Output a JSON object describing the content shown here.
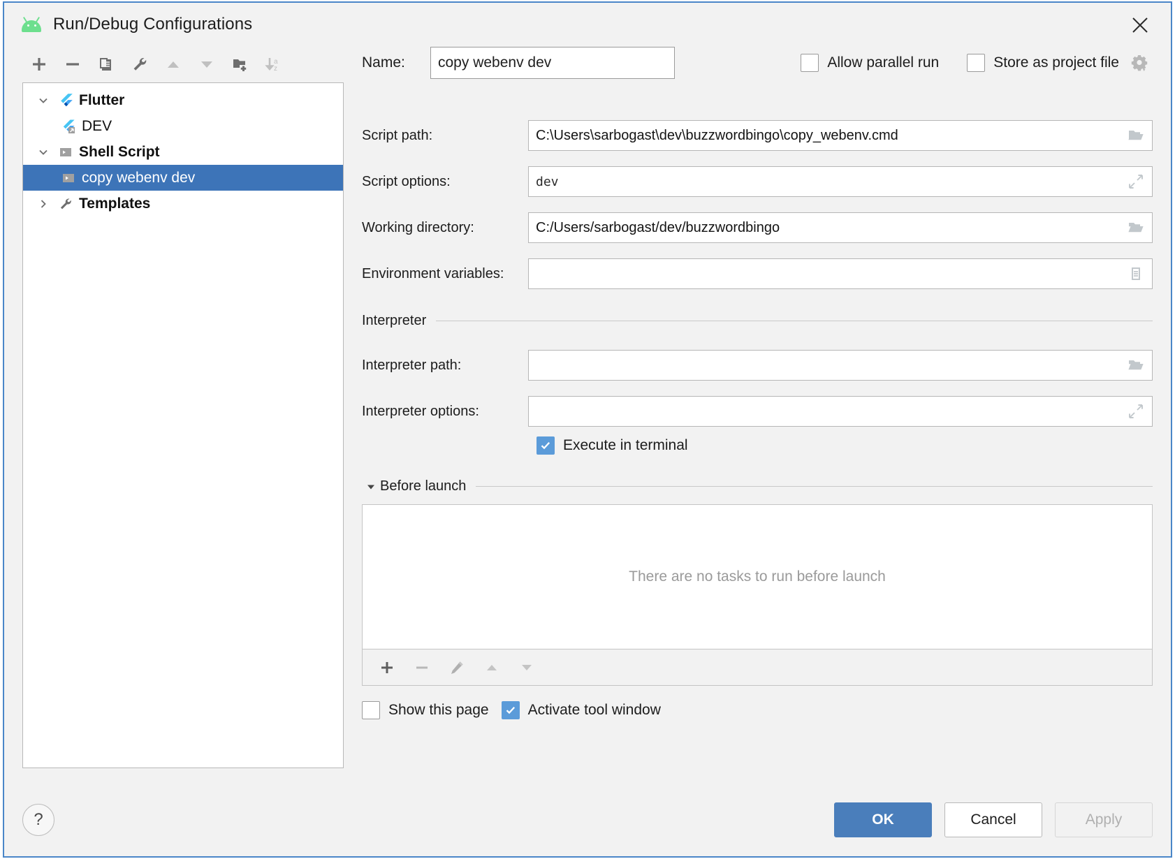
{
  "window": {
    "title": "Run/Debug Configurations",
    "app_icon": "android-icon",
    "close_icon": "close-icon"
  },
  "tree_toolbar": {
    "buttons": [
      {
        "name": "add-configuration-button",
        "icon": "plus-icon"
      },
      {
        "name": "remove-configuration-button",
        "icon": "minus-icon"
      },
      {
        "name": "copy-configuration-button",
        "icon": "copy-icon"
      },
      {
        "name": "edit-templates-button",
        "icon": "wrench-icon"
      },
      {
        "name": "move-up-button",
        "icon": "arrow-up-icon"
      },
      {
        "name": "move-down-button",
        "icon": "arrow-down-icon"
      },
      {
        "name": "new-folder-button",
        "icon": "folder-add-icon"
      },
      {
        "name": "sort-alphabetically-button",
        "icon": "sort-az-icon"
      }
    ]
  },
  "tree": {
    "nodes": [
      {
        "label": "Flutter",
        "level": 0,
        "expanded": true,
        "icon": "flutter-icon",
        "bold": true,
        "selected": false
      },
      {
        "label": "DEV",
        "level": 1,
        "expanded": null,
        "icon": "flutter-run-icon",
        "bold": false,
        "selected": false
      },
      {
        "label": "Shell Script",
        "level": 0,
        "expanded": true,
        "icon": "shell-script-icon",
        "bold": true,
        "selected": false
      },
      {
        "label": "copy webenv dev",
        "level": 1,
        "expanded": null,
        "icon": "shell-script-icon",
        "bold": false,
        "selected": true
      },
      {
        "label": "Templates",
        "level": 0,
        "expanded": false,
        "icon": "wrench-icon",
        "bold": true,
        "selected": false
      }
    ]
  },
  "name_row": {
    "label": "Name:",
    "value": "copy webenv dev",
    "allow_parallel_run": {
      "label": "Allow parallel run",
      "checked": false
    },
    "store_as_project_file": {
      "label": "Store as project file",
      "checked": false
    },
    "gear_icon": "gear-dropdown-icon"
  },
  "fields": {
    "script_path": {
      "label": "Script path:",
      "value": "C:\\Users\\sarbogast\\dev\\buzzwordbingo\\copy_webenv.cmd",
      "icon": "folder-open-icon",
      "mono": false
    },
    "script_options": {
      "label": "Script options:",
      "value": "dev",
      "icon": "expand-arrows-icon",
      "mono": true
    },
    "working_directory": {
      "label": "Working directory:",
      "value": "C:/Users/sarbogast/dev/buzzwordbingo",
      "icon": "folder-open-icon",
      "mono": false
    },
    "environment_variables": {
      "label": "Environment variables:",
      "value": "",
      "icon": "list-edit-icon",
      "mono": false
    },
    "interpreter_path": {
      "label": "Interpreter path:",
      "value": "",
      "icon": "folder-open-icon",
      "mono": false
    },
    "interpreter_options": {
      "label": "Interpreter options:",
      "value": "",
      "icon": "expand-arrows-icon",
      "mono": false
    }
  },
  "interpreter_section": {
    "title": "Interpreter"
  },
  "execute_in_terminal": {
    "label": "Execute in terminal",
    "checked": true
  },
  "before_launch": {
    "title": "Before launch",
    "expanded": true,
    "empty_text": "There are no tasks to run before launch",
    "toolbar": [
      {
        "name": "add-task-button",
        "icon": "plus-icon"
      },
      {
        "name": "remove-task-button",
        "icon": "minus-icon"
      },
      {
        "name": "edit-task-button",
        "icon": "pencil-icon"
      },
      {
        "name": "task-move-up-button",
        "icon": "arrow-up-icon"
      },
      {
        "name": "task-move-down-button",
        "icon": "arrow-down-icon"
      }
    ]
  },
  "bottom_checks": {
    "show_this_page": {
      "label": "Show this page",
      "checked": false
    },
    "activate_tool_window": {
      "label": "Activate tool window",
      "checked": true
    }
  },
  "footer": {
    "help_label": "?",
    "ok": "OK",
    "cancel": "Cancel",
    "apply": "Apply",
    "apply_disabled": true
  },
  "colors": {
    "accent": "#4a7ebb",
    "selection": "#3d74b8",
    "checkbox_checked": "#5b9bd9",
    "dialog_border": "#4a86c8",
    "background": "#f2f2f2"
  }
}
